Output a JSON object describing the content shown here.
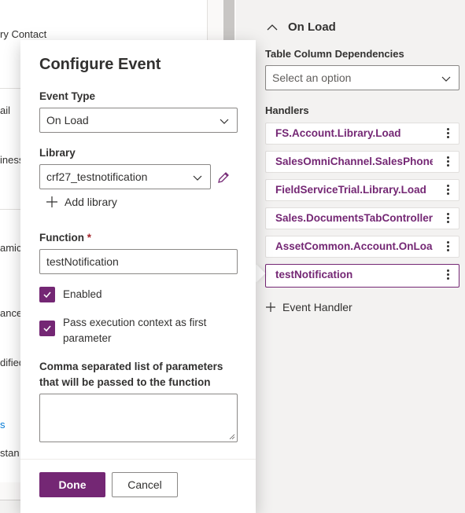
{
  "background_form": {
    "fragments": [
      "ry Contact",
      "ail",
      "iness",
      "amic",
      "ance",
      "dified",
      "s",
      "stan"
    ]
  },
  "properties_panel": {
    "section_title": "On Load",
    "dependencies_label": "Table Column Dependencies",
    "dependencies_placeholder": "Select an option",
    "handlers_label": "Handlers",
    "handlers": [
      {
        "label": "FS.Account.Library.Load"
      },
      {
        "label": "SalesOmniChannel.SalesPhoneNumber"
      },
      {
        "label": "FieldServiceTrial.Library.Load"
      },
      {
        "label": "Sales.DocumentsTabController.s"
      },
      {
        "label": "AssetCommon.Account.OnLoad"
      },
      {
        "label": "testNotification"
      }
    ],
    "add_handler_label": "Event Handler"
  },
  "dialog": {
    "title": "Configure Event",
    "event_type_label": "Event Type",
    "event_type_value": "On Load",
    "library_label": "Library",
    "library_value": "crf27_testnotification",
    "add_library_label": "Add library",
    "function_label": "Function",
    "function_required_mark": "*",
    "function_value": "testNotification",
    "enabled_label": "Enabled",
    "enabled_checked": true,
    "pass_context_label": "Pass execution context as first parameter",
    "pass_context_checked": true,
    "parameters_label": "Comma separated list of parameters that will be passed to the function",
    "parameters_value": "",
    "done_label": "Done",
    "cancel_label": "Cancel"
  },
  "colors": {
    "accent": "#742774",
    "panel_bg": "#f3f2f1",
    "border": "#8a8886"
  }
}
